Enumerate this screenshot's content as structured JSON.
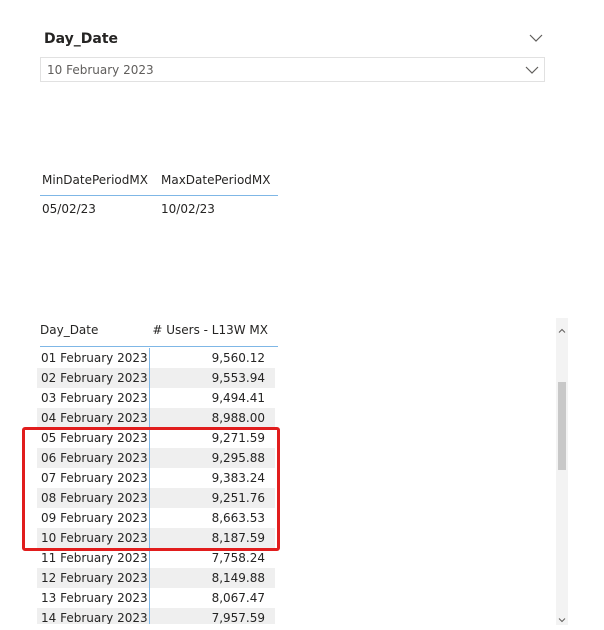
{
  "slicer": {
    "title": "Day_Date",
    "selected_value": "10 February 2023"
  },
  "minmax_table": {
    "headers": [
      "MinDatePeriodMX",
      "MaxDatePeriodMX"
    ],
    "row": [
      "05/02/23",
      "10/02/23"
    ]
  },
  "main_table": {
    "headers": [
      "Day_Date",
      "# Users - L13W MX"
    ],
    "rows": [
      {
        "date": "01 February 2023",
        "value": "9,560.12"
      },
      {
        "date": "02 February 2023",
        "value": "9,553.94"
      },
      {
        "date": "03 February 2023",
        "value": "9,494.41"
      },
      {
        "date": "04 February 2023",
        "value": "8,988.00"
      },
      {
        "date": "05 February 2023",
        "value": "9,271.59"
      },
      {
        "date": "06 February 2023",
        "value": "9,295.88"
      },
      {
        "date": "07 February 2023",
        "value": "9,383.24"
      },
      {
        "date": "08 February 2023",
        "value": "9,251.76"
      },
      {
        "date": "09 February 2023",
        "value": "8,663.53"
      },
      {
        "date": "10 February 2023",
        "value": "8,187.59"
      },
      {
        "date": "11 February 2023",
        "value": "7,758.24"
      },
      {
        "date": "12 February 2023",
        "value": "8,149.88"
      },
      {
        "date": "13 February 2023",
        "value": "8,067.47"
      },
      {
        "date": "14 February 2023",
        "value": "7,957.59"
      }
    ]
  },
  "icons": {
    "slicer_collapse": "chevron-down-icon",
    "dropdown": "chevron-down-icon",
    "scroll_up": "chevron-up-icon",
    "scroll_down": "chevron-down-icon"
  },
  "colors": {
    "highlight": "#e11d1d",
    "header_rule": "#7fb7e6",
    "alt_row": "#efefef"
  }
}
